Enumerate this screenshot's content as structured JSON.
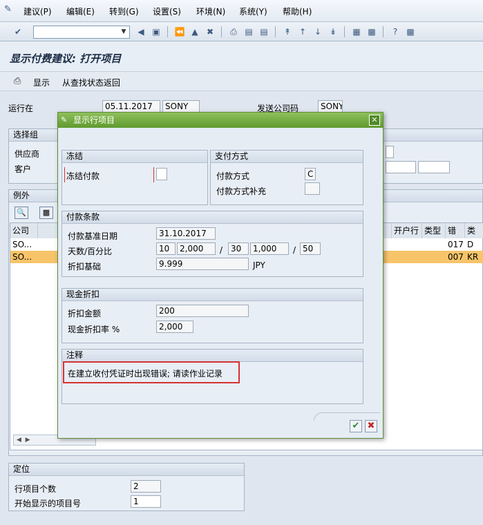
{
  "menu": {
    "items": [
      "建议(P)",
      "编辑(E)",
      "转到(G)",
      "设置(S)",
      "环境(N)",
      "系统(Y)",
      "帮助(H)"
    ]
  },
  "toolbar": {
    "command_value": ""
  },
  "screen": {
    "title": "显示付费建议: 打开项目",
    "display_btn": "显示",
    "back_btn": "从查找状态返回"
  },
  "header": {
    "run_on_label": "运行在",
    "run_date": "05.11.2017",
    "run_id": "SONY",
    "paying_cc_label": "发送公司码",
    "paying_cc": "SONY"
  },
  "selection": {
    "title": "选择组",
    "vendor_label": "供应商",
    "customer_label": "客户"
  },
  "exceptions": {
    "title": "例外",
    "col_company": "公司",
    "col_bank": "开户行",
    "col_type": "类型",
    "col_err": "错",
    "col_cls": "类",
    "row1_company": "SO...",
    "row1_err": "017",
    "row1_cls": "D",
    "row2_company": "SO...",
    "row2_err": "007",
    "row2_cls": "KR"
  },
  "position": {
    "title": "定位",
    "count_label": "行项目个数",
    "count_value": "2",
    "start_label": "开始显示的项目号",
    "start_value": "1"
  },
  "dialog": {
    "title": "显示行项目",
    "block": {
      "title": "冻结",
      "label": "冻结付款",
      "value": ""
    },
    "paymethod": {
      "title": "支付方式",
      "method_label": "付款方式",
      "method_value": "C",
      "supplement_label": "付款方式补充",
      "supplement_value": ""
    },
    "terms": {
      "title": "付款条款",
      "baseline_label": "付款基准日期",
      "baseline_value": "31.10.2017",
      "days_label": "天数/百分比",
      "days1": "10",
      "pct1": "2,000",
      "days2": "30",
      "pct2": "1,000",
      "days3": "50",
      "slash": "/",
      "base_label": "折扣基础",
      "base_value": "9.999",
      "currency": "JPY"
    },
    "discount": {
      "title": "现金折扣",
      "amount_label": "折扣金额",
      "amount_value": "200",
      "rate_label": "现金折扣率 %",
      "rate_value": "2,000"
    },
    "notes": {
      "title": "注释",
      "text": "在建立收付凭证时出现错误; 请读作业记录"
    }
  },
  "colors": {
    "dialog_title": "#6aa63a",
    "highlight_row": "#f7c46a",
    "red_box": "#d83030"
  }
}
